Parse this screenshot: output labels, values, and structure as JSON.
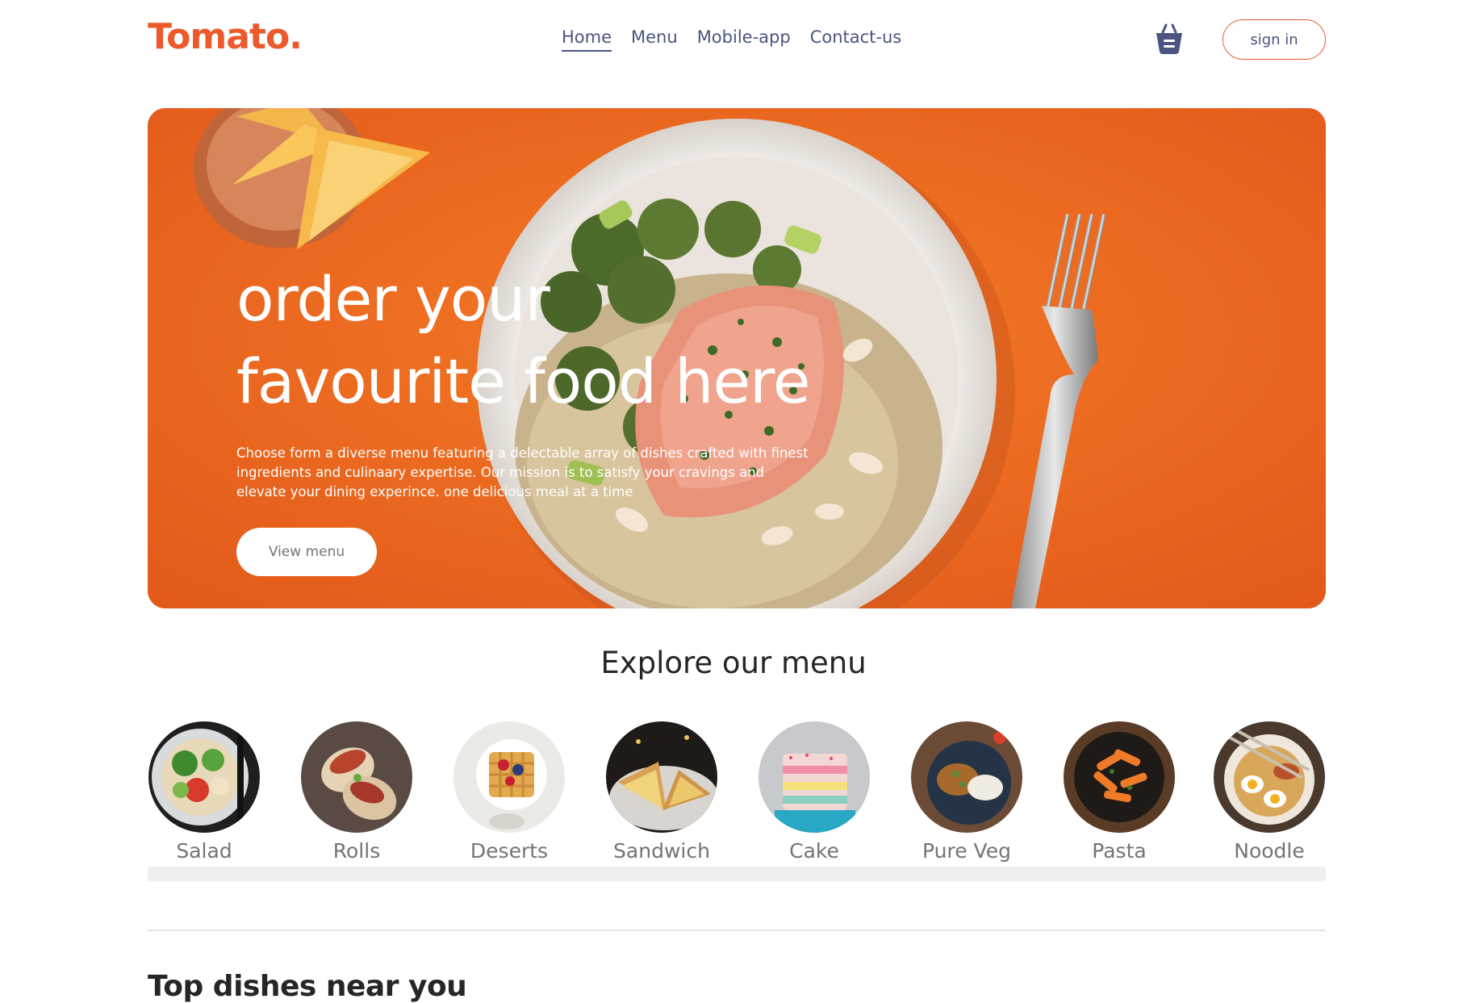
{
  "brand": {
    "logo": "Tomato.",
    "accent": "#ec5a2c",
    "text": "#49557e"
  },
  "nav": {
    "items": [
      {
        "label": "Home",
        "active": true
      },
      {
        "label": "Menu",
        "active": false
      },
      {
        "label": "Mobile-app",
        "active": false
      },
      {
        "label": "Contact-us",
        "active": false
      }
    ],
    "basket_icon": "basket-icon",
    "signin_label": "sign in"
  },
  "hero": {
    "title_line1": "order your",
    "title_line2": "favourite food here",
    "description": "Choose form a diverse menu featuring a delectable array of dishes crafted with finest ingredients and culinaary expertise. Our mission is to satisfy your cravings and elevate your dining experince. one delicious meal at a time",
    "button_label": "View menu",
    "background": "#f06a1e"
  },
  "explore": {
    "title": "Explore our menu",
    "items": [
      {
        "label": "Salad"
      },
      {
        "label": "Rolls"
      },
      {
        "label": "Deserts"
      },
      {
        "label": "Sandwich"
      },
      {
        "label": "Cake"
      },
      {
        "label": "Pure Veg"
      },
      {
        "label": "Pasta"
      },
      {
        "label": "Noodle"
      }
    ]
  },
  "top_dishes": {
    "title": "Top dishes near you"
  }
}
